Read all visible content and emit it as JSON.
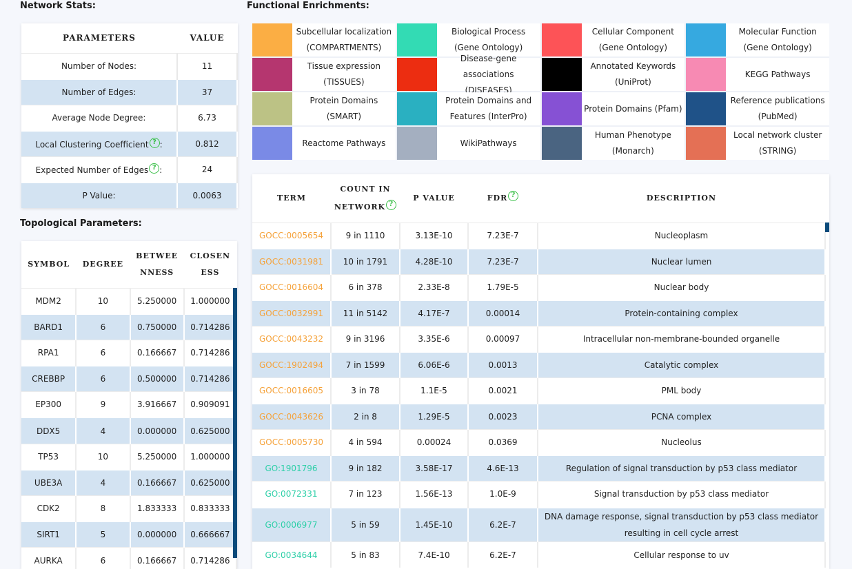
{
  "sections": {
    "network_stats": "Network Stats:",
    "functional_enrichments": "Functional Enrichments:",
    "topological_parameters": "Topological Parameters:"
  },
  "help_glyph": "?",
  "stats": {
    "headers": [
      "PARAMETERS",
      "VALUE"
    ],
    "rows": [
      {
        "label": "Number of Nodes:",
        "value": "11",
        "help": false
      },
      {
        "label": "Number of Edges:",
        "value": "37",
        "help": false
      },
      {
        "label": "Average Node Degree:",
        "value": "6.73",
        "help": false
      },
      {
        "label": "Local Clustering Coefficient",
        "suffix": ":",
        "value": "0.812",
        "help": true
      },
      {
        "label": "Expected Number of Edges",
        "suffix": ":",
        "value": "24",
        "help": true
      },
      {
        "label": "P Value:",
        "value": "0.0063",
        "help": false
      }
    ]
  },
  "topology": {
    "headers": [
      "SYMBOL",
      "DEGREE",
      "BETWEE NNESS",
      "CLOSEN ESS"
    ],
    "header_lines": [
      [
        "SYMBOL"
      ],
      [
        "DEGREE"
      ],
      [
        "BETWEE",
        "NNESS"
      ],
      [
        "CLOSEN",
        "ESS"
      ]
    ],
    "rows": [
      [
        "MDM2",
        "10",
        "5.250000",
        "1.000000"
      ],
      [
        "BARD1",
        "6",
        "0.750000",
        "0.714286"
      ],
      [
        "RPA1",
        "6",
        "0.166667",
        "0.714286"
      ],
      [
        "CREBBP",
        "6",
        "0.500000",
        "0.714286"
      ],
      [
        "EP300",
        "9",
        "3.916667",
        "0.909091"
      ],
      [
        "DDX5",
        "4",
        "0.000000",
        "0.625000"
      ],
      [
        "TP53",
        "10",
        "5.250000",
        "1.000000"
      ],
      [
        "UBE3A",
        "4",
        "0.166667",
        "0.625000"
      ],
      [
        "CDK2",
        "8",
        "1.833333",
        "0.833333"
      ],
      [
        "SIRT1",
        "5",
        "0.000000",
        "0.666667"
      ],
      [
        "AURKA",
        "6",
        "0.166667",
        "0.714286"
      ]
    ]
  },
  "legend": [
    {
      "label": "Subcellular localization (COMPARTMENTS)",
      "color": "#fbae44"
    },
    {
      "label": "Biological Process (Gene Ontology)",
      "color": "#33dbb4"
    },
    {
      "label": "Cellular Component (Gene Ontology)",
      "color": "#fd5357"
    },
    {
      "label": "Molecular Function (Gene Ontology)",
      "color": "#36a9e0"
    },
    {
      "label": "Tissue expression (TISSUES)",
      "color": "#b5366f"
    },
    {
      "label": "Disease-gene associations (DISEASES)",
      "color": "#ec2d11"
    },
    {
      "label": "Annotated Keywords (UniProt)",
      "color": "#000000"
    },
    {
      "label": "KEGG Pathways",
      "color": "#f78ab3"
    },
    {
      "label": "Protein Domains (SMART)",
      "color": "#bcc285"
    },
    {
      "label": "Protein Domains and Features (InterPro)",
      "color": "#2ab0c1"
    },
    {
      "label": "Protein Domains (Pfam)",
      "color": "#8651d4"
    },
    {
      "label": "Reference publications (PubMed)",
      "color": "#1f5288"
    },
    {
      "label": "Reactome Pathways",
      "color": "#7a8ae6"
    },
    {
      "label": "WikiPathways",
      "color": "#a4afc0"
    },
    {
      "label": "Human Phenotype (Monarch)",
      "color": "#4a6481"
    },
    {
      "label": "Local network cluster (STRING)",
      "color": "#e47055"
    }
  ],
  "enrichment": {
    "headers": [
      "TERM",
      "COUNT IN NETWORK",
      "P VALUE",
      "FDR",
      "DESCRIPTION"
    ],
    "count_header_lines": [
      "COUNT IN",
      "NETWORK"
    ],
    "rows": [
      {
        "term": "GOCC:0005654",
        "cat": "cc",
        "count": "9 in 1110",
        "p": "3.13E-10",
        "fdr": "7.23E-7",
        "desc": "Nucleoplasm"
      },
      {
        "term": "GOCC:0031981",
        "cat": "cc",
        "count": "10 in 1791",
        "p": "4.28E-10",
        "fdr": "7.23E-7",
        "desc": "Nuclear lumen"
      },
      {
        "term": "GOCC:0016604",
        "cat": "cc",
        "count": "6 in 378",
        "p": "2.33E-8",
        "fdr": "1.79E-5",
        "desc": "Nuclear body"
      },
      {
        "term": "GOCC:0032991",
        "cat": "cc",
        "count": "11 in 5142",
        "p": "4.17E-7",
        "fdr": "0.00014",
        "desc": "Protein-containing complex"
      },
      {
        "term": "GOCC:0043232",
        "cat": "cc",
        "count": "9 in 3196",
        "p": "3.35E-6",
        "fdr": "0.00097",
        "desc": "Intracellular non-membrane-bounded organelle"
      },
      {
        "term": "GOCC:1902494",
        "cat": "cc",
        "count": "7 in 1599",
        "p": "6.06E-6",
        "fdr": "0.0013",
        "desc": "Catalytic complex"
      },
      {
        "term": "GOCC:0016605",
        "cat": "cc",
        "count": "3 in 78",
        "p": "1.1E-5",
        "fdr": "0.0021",
        "desc": "PML body"
      },
      {
        "term": "GOCC:0043626",
        "cat": "cc",
        "count": "2 in 8",
        "p": "1.29E-5",
        "fdr": "0.0023",
        "desc": "PCNA complex"
      },
      {
        "term": "GOCC:0005730",
        "cat": "cc",
        "count": "4 in 594",
        "p": "0.00024",
        "fdr": "0.0369",
        "desc": "Nucleolus"
      },
      {
        "term": "GO:1901796",
        "cat": "bp",
        "count": "9 in 182",
        "p": "3.58E-17",
        "fdr": "4.6E-13",
        "desc": "Regulation of signal transduction by p53 class mediator"
      },
      {
        "term": "GO:0072331",
        "cat": "bp",
        "count": "7 in 123",
        "p": "1.56E-13",
        "fdr": "1.0E-9",
        "desc": "Signal transduction by p53 class mediator"
      },
      {
        "term": "GO:0006977",
        "cat": "bp",
        "count": "5 in 59",
        "p": "1.45E-10",
        "fdr": "6.2E-7",
        "desc": "DNA damage response, signal transduction by p53 class mediator resulting in cell cycle arrest",
        "tall": true
      },
      {
        "term": "GO:0034644",
        "cat": "bp",
        "count": "5 in 83",
        "p": "7.4E-10",
        "fdr": "6.2E-7",
        "desc": "Cellular response to uv"
      }
    ]
  }
}
